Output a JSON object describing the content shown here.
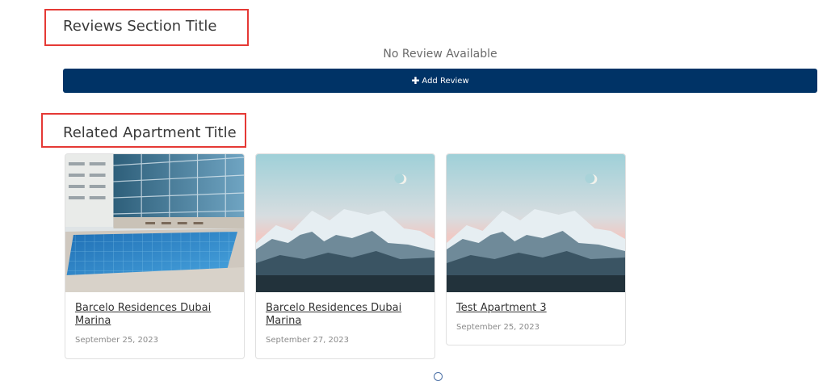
{
  "reviews": {
    "title": "Reviews Section Title",
    "empty_message": "No Review Available",
    "add_button_label": "Add Review",
    "add_button_icon": "plus-icon"
  },
  "related": {
    "title": "Related Apartment Title",
    "cards": [
      {
        "title": "Barcelo Residences Dubai Marina",
        "date": "September 25, 2023",
        "image": "pool-building-photo"
      },
      {
        "title": "Barcelo Residences Dubai Marina",
        "date": "September 27, 2023",
        "image": "snowy-mountains-photo"
      },
      {
        "title": "Test Apartment 3",
        "date": "September 25, 2023",
        "image": "snowy-mountains-photo"
      }
    ]
  },
  "colors": {
    "accent": "#003366",
    "annotation": "#e53935"
  }
}
